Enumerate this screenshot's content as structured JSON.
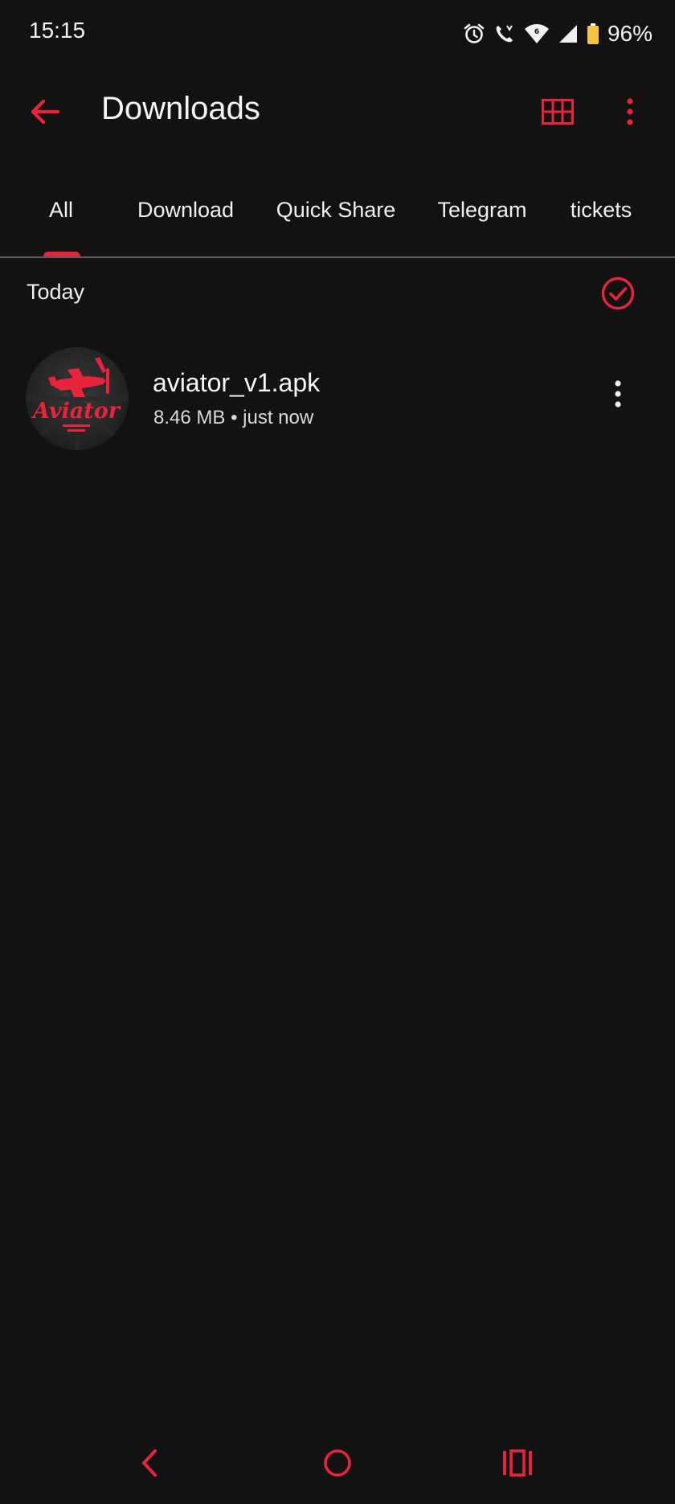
{
  "status_bar": {
    "time": "15:15",
    "battery": "96%",
    "icons": [
      "alarm-icon",
      "wifi-calling-icon",
      "wifi-icon",
      "signal-icon",
      "battery-icon"
    ]
  },
  "app_bar": {
    "title": "Downloads",
    "icons": [
      "back-arrow-icon",
      "grid-view-icon",
      "more-vert-icon"
    ]
  },
  "tabs": [
    {
      "label": "All",
      "selected": true
    },
    {
      "label": "Download",
      "selected": false
    },
    {
      "label": "Quick Share",
      "selected": false
    },
    {
      "label": "Telegram",
      "selected": false
    },
    {
      "label": "tickets",
      "selected": false
    }
  ],
  "section": {
    "title": "Today",
    "icon": "select-all-check-icon"
  },
  "files": [
    {
      "name": "aviator_v1.apk",
      "size": "8.46 MB",
      "separator": "•",
      "time": "just now",
      "thumbnail_text": "Aviator",
      "icon": "aviator-app-icon"
    }
  ],
  "nav_bar": {
    "icons": [
      "nav-back-icon",
      "nav-home-icon",
      "nav-recents-icon"
    ]
  },
  "colors": {
    "accent": "#e8243c",
    "background": "#121212",
    "text": "#f4f4f4",
    "battery": "#f5c542"
  }
}
